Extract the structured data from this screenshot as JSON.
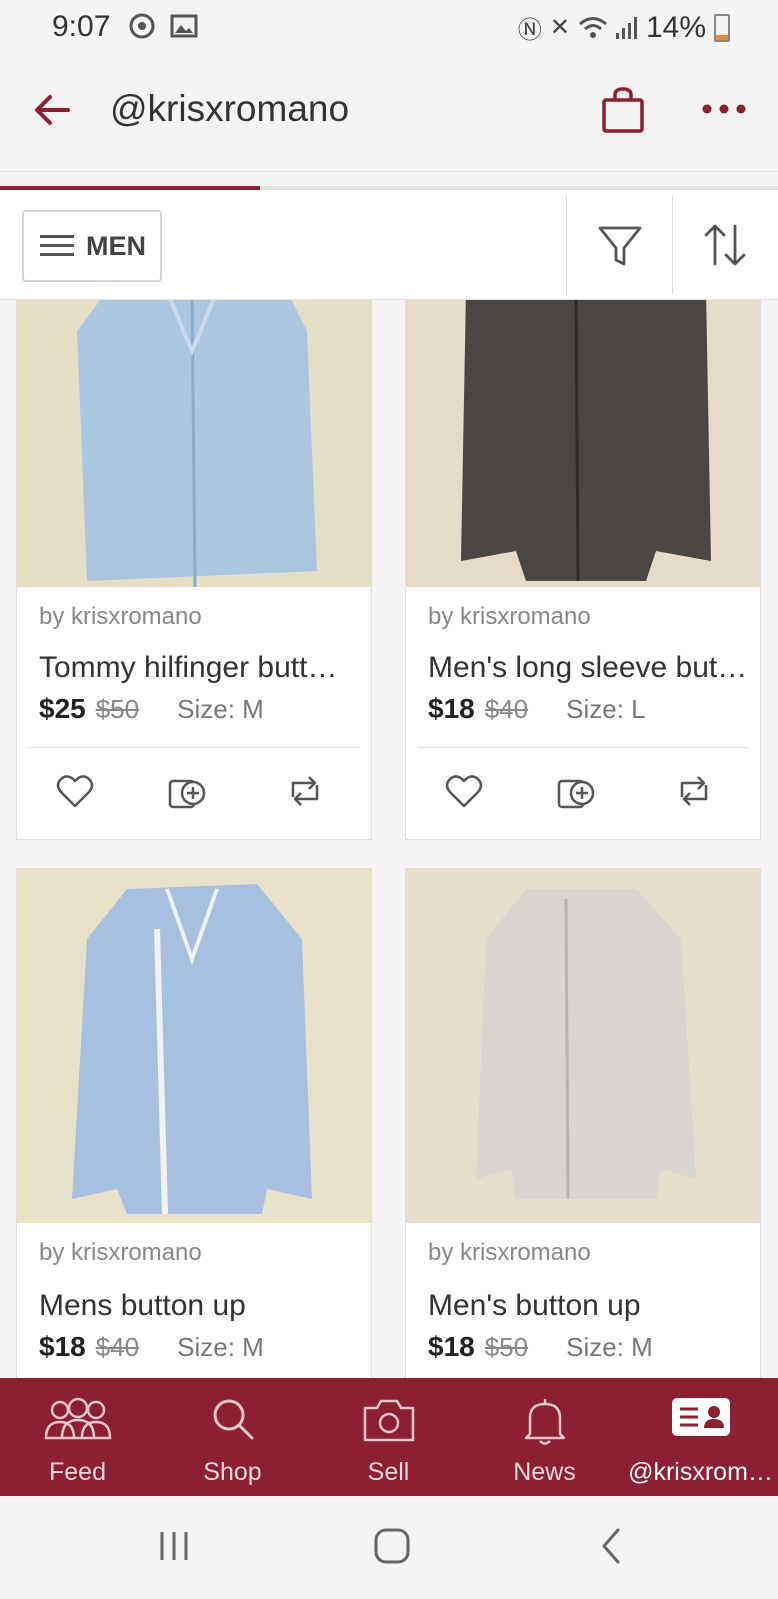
{
  "status_bar": {
    "time": "9:07",
    "battery": "14%"
  },
  "app_bar": {
    "title": "@krisxromano"
  },
  "filter_bar": {
    "category_label": "MEN"
  },
  "listings": [
    {
      "seller": "by krisxromano",
      "title": "Tommy hilfinger butt…",
      "price": "$25",
      "original_price": "$50",
      "size": "Size: M",
      "shirt_color": "#aac4e2"
    },
    {
      "seller": "by krisxromano",
      "title": "Men's long sleeve but…",
      "price": "$18",
      "original_price": "$40",
      "size": "Size: L",
      "shirt_color": "#4a4643"
    },
    {
      "seller": "by krisxromano",
      "title": "Mens button up",
      "price": "$18",
      "original_price": "$40",
      "size": "Size: M",
      "shirt_color": "#a9bfe0"
    },
    {
      "seller": "by krisxromano",
      "title": "Men's button up",
      "price": "$18",
      "original_price": "$50",
      "size": "Size: M",
      "shirt_color": "#d9d6cf"
    }
  ],
  "bottom_nav": {
    "items": [
      {
        "label": "Feed",
        "icon": "people-icon"
      },
      {
        "label": "Shop",
        "icon": "search-icon"
      },
      {
        "label": "Sell",
        "icon": "camera-icon"
      },
      {
        "label": "News",
        "icon": "bell-icon"
      },
      {
        "label": "@krisxrom…",
        "icon": "profile-card-icon"
      }
    ]
  },
  "colors": {
    "brand": "#8c1f31",
    "background": "#f5f3f3"
  }
}
